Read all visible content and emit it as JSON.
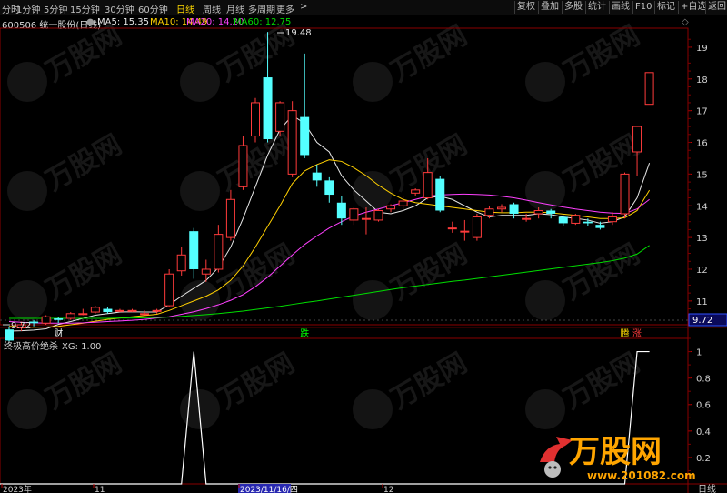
{
  "toolbar": {
    "tabs": [
      {
        "label": "分时",
        "active": false
      },
      {
        "label": "1分钟",
        "active": false
      },
      {
        "label": "5分钟",
        "active": false
      },
      {
        "label": "15分钟",
        "active": false
      },
      {
        "label": "30分钟",
        "active": false
      },
      {
        "label": "60分钟",
        "active": false
      },
      {
        "label": "日线",
        "active": true
      },
      {
        "label": "周线",
        "active": false
      },
      {
        "label": "月线",
        "active": false
      },
      {
        "label": "多周期",
        "active": false
      },
      {
        "label": "更多",
        "active": false
      }
    ],
    "more_arrow": ">",
    "right_buttons": [
      "复权",
      "叠加",
      "多股",
      "统计",
      "画线",
      "F10",
      "标记",
      "+自选",
      "返回"
    ]
  },
  "info": {
    "stock": "600506 统一股份(日线)",
    "ma5": "MA5: 15.35",
    "ma10": "MA10: 14.49",
    "ma20": "MA20: 14.20",
    "ma60": "MA60: 12.75",
    "diamond": "◇"
  },
  "indicator": {
    "title": "终极高价绝杀",
    "value": "XG: 1.00",
    "period_label": "日线"
  },
  "colors": {
    "up": "#ff3b3b",
    "down": "#54ffff",
    "ma5": "#e8e8e8",
    "ma10": "#ffd000",
    "ma20": "#ff40ff",
    "ma60": "#00dd00",
    "signal": "#ffffff",
    "axis": "#c00000"
  },
  "watermark": {
    "logo_text": "万股网",
    "logo_url": "www.201082.com"
  },
  "chart_data": [
    {
      "type": "candlestick",
      "title": "600506 统一股份(日线)",
      "y_ticks": [
        11.0,
        12.0,
        13.0,
        14.0,
        15.0,
        16.0,
        17.0,
        18.0,
        19.0
      ],
      "ylim": [
        10.25,
        19.6
      ],
      "current_price": "9.72",
      "high_label": "19.48",
      "low_label": "9.72",
      "x_ticks": [
        "2023年",
        "11",
        "2023/11/16/四",
        "12"
      ],
      "markers": [
        {
          "index": 4,
          "text": "财",
          "color": "#ffffff"
        },
        {
          "index": 24,
          "text": "跌",
          "color": "#00ff00"
        },
        {
          "index": 50,
          "text": "腾",
          "color": "#ffd800"
        },
        {
          "index": 51,
          "text": "涨",
          "color": "#ff3b3b"
        }
      ],
      "candles": [
        {
          "o": 10.1,
          "c": 9.75,
          "h": 10.2,
          "l": 9.72
        },
        {
          "o": 10.15,
          "c": 10.25,
          "h": 10.35,
          "l": 10.05
        },
        {
          "o": 10.35,
          "c": 10.3,
          "h": 10.4,
          "l": 10.2
        },
        {
          "o": 10.3,
          "c": 10.5,
          "h": 10.55,
          "l": 10.25
        },
        {
          "o": 10.45,
          "c": 10.4,
          "h": 10.5,
          "l": 10.3
        },
        {
          "o": 10.45,
          "c": 10.6,
          "h": 10.65,
          "l": 10.4
        },
        {
          "o": 10.6,
          "c": 10.6,
          "h": 10.75,
          "l": 10.55
        },
        {
          "o": 10.65,
          "c": 10.8,
          "h": 10.85,
          "l": 10.6
        },
        {
          "o": 10.75,
          "c": 10.65,
          "h": 10.8,
          "l": 10.6
        },
        {
          "o": 10.7,
          "c": 10.7,
          "h": 10.75,
          "l": 10.65
        },
        {
          "o": 10.7,
          "c": 10.7,
          "h": 10.75,
          "l": 10.65
        },
        {
          "o": 10.6,
          "c": 10.6,
          "h": 10.7,
          "l": 10.55
        },
        {
          "o": 10.7,
          "c": 10.7,
          "h": 10.75,
          "l": 10.6
        },
        {
          "o": 10.85,
          "c": 11.85,
          "h": 12.0,
          "l": 10.8
        },
        {
          "o": 11.95,
          "c": 12.45,
          "h": 12.7,
          "l": 11.8
        },
        {
          "o": 13.2,
          "c": 12.0,
          "h": 13.3,
          "l": 11.7
        },
        {
          "o": 11.85,
          "c": 12.0,
          "h": 12.3,
          "l": 11.6
        },
        {
          "o": 12.0,
          "c": 13.1,
          "h": 13.4,
          "l": 11.9
        },
        {
          "o": 13.0,
          "c": 14.2,
          "h": 14.5,
          "l": 12.9
        },
        {
          "o": 14.6,
          "c": 15.9,
          "h": 16.2,
          "l": 14.5
        },
        {
          "o": 16.2,
          "c": 17.25,
          "h": 17.4,
          "l": 16.0
        },
        {
          "o": 18.05,
          "c": 16.1,
          "h": 19.48,
          "l": 16.0
        },
        {
          "o": 16.35,
          "c": 17.25,
          "h": 17.3,
          "l": 16.2
        },
        {
          "o": 15.0,
          "c": 17.0,
          "h": 17.3,
          "l": 14.9
        },
        {
          "o": 16.8,
          "c": 15.6,
          "h": 18.8,
          "l": 15.5
        },
        {
          "o": 15.05,
          "c": 14.8,
          "h": 15.3,
          "l": 14.6
        },
        {
          "o": 14.8,
          "c": 14.35,
          "h": 14.9,
          "l": 14.1
        },
        {
          "o": 14.1,
          "c": 13.6,
          "h": 14.3,
          "l": 13.4
        },
        {
          "o": 13.55,
          "c": 13.9,
          "h": 13.95,
          "l": 13.4
        },
        {
          "o": 13.6,
          "c": 13.6,
          "h": 13.95,
          "l": 13.1
        },
        {
          "o": 13.55,
          "c": 13.85,
          "h": 13.9,
          "l": 13.5
        },
        {
          "o": 13.9,
          "c": 14.0,
          "h": 14.05,
          "l": 13.8
        },
        {
          "o": 14.0,
          "c": 14.15,
          "h": 14.3,
          "l": 13.9
        },
        {
          "o": 14.4,
          "c": 14.5,
          "h": 14.55,
          "l": 14.3
        },
        {
          "o": 14.25,
          "c": 15.05,
          "h": 15.5,
          "l": 14.2
        },
        {
          "o": 14.85,
          "c": 13.85,
          "h": 14.95,
          "l": 13.8
        },
        {
          "o": 13.3,
          "c": 13.3,
          "h": 13.5,
          "l": 13.15
        },
        {
          "o": 13.2,
          "c": 13.2,
          "h": 13.55,
          "l": 12.9
        },
        {
          "o": 13.0,
          "c": 13.65,
          "h": 13.75,
          "l": 12.9
        },
        {
          "o": 13.7,
          "c": 13.9,
          "h": 14.0,
          "l": 13.6
        },
        {
          "o": 13.9,
          "c": 13.95,
          "h": 14.05,
          "l": 13.8
        },
        {
          "o": 14.05,
          "c": 13.75,
          "h": 14.1,
          "l": 13.6
        },
        {
          "o": 13.6,
          "c": 13.6,
          "h": 13.75,
          "l": 13.5
        },
        {
          "o": 13.75,
          "c": 13.85,
          "h": 13.95,
          "l": 13.6
        },
        {
          "o": 13.85,
          "c": 13.75,
          "h": 13.9,
          "l": 13.6
        },
        {
          "o": 13.65,
          "c": 13.45,
          "h": 13.7,
          "l": 13.35
        },
        {
          "o": 13.45,
          "c": 13.7,
          "h": 13.75,
          "l": 13.4
        },
        {
          "o": 13.5,
          "c": 13.45,
          "h": 13.6,
          "l": 13.35
        },
        {
          "o": 13.4,
          "c": 13.3,
          "h": 13.5,
          "l": 13.25
        },
        {
          "o": 13.5,
          "c": 13.65,
          "h": 13.8,
          "l": 13.4
        },
        {
          "o": 13.75,
          "c": 15.0,
          "h": 15.05,
          "l": 13.6
        },
        {
          "o": 15.7,
          "c": 16.5,
          "h": 16.5,
          "l": 14.95
        },
        {
          "o": 17.2,
          "c": 18.2,
          "h": 18.2,
          "l": 17.2
        }
      ],
      "series": [
        {
          "name": "MA5",
          "values": [
            10.05,
            10.06,
            10.08,
            10.12,
            10.26,
            10.35,
            10.45,
            10.55,
            10.6,
            10.65,
            10.66,
            10.65,
            10.65,
            10.88,
            11.15,
            11.4,
            11.65,
            12.05,
            12.7,
            13.6,
            14.6,
            15.6,
            16.4,
            16.85,
            16.6,
            16.0,
            15.7,
            14.95,
            14.5,
            14.15,
            13.8,
            13.75,
            13.85,
            14.0,
            14.25,
            14.3,
            14.2,
            14.0,
            13.8,
            13.65,
            13.7,
            13.7,
            13.7,
            13.75,
            13.72,
            13.65,
            13.6,
            13.55,
            13.45,
            13.5,
            13.65,
            14.25,
            15.35
          ]
        },
        {
          "name": "MA10",
          "values": [
            10.2,
            10.18,
            10.17,
            10.18,
            10.2,
            10.25,
            10.3,
            10.36,
            10.42,
            10.46,
            10.5,
            10.54,
            10.58,
            10.7,
            10.85,
            11.0,
            11.15,
            11.35,
            11.65,
            12.1,
            12.7,
            13.35,
            14.0,
            14.7,
            15.1,
            15.3,
            15.45,
            15.4,
            15.2,
            14.95,
            14.65,
            14.4,
            14.2,
            14.1,
            14.05,
            14.0,
            13.95,
            13.9,
            13.85,
            13.8,
            13.78,
            13.78,
            13.8,
            13.8,
            13.78,
            13.74,
            13.7,
            13.65,
            13.6,
            13.6,
            13.62,
            13.85,
            14.49
          ]
        },
        {
          "name": "MA20",
          "values": [
            10.35,
            10.33,
            10.31,
            10.3,
            10.3,
            10.3,
            10.31,
            10.33,
            10.35,
            10.37,
            10.39,
            10.42,
            10.46,
            10.5,
            10.58,
            10.66,
            10.76,
            10.88,
            11.02,
            11.2,
            11.45,
            11.75,
            12.1,
            12.45,
            12.78,
            13.05,
            13.3,
            13.5,
            13.68,
            13.8,
            13.9,
            14.0,
            14.1,
            14.2,
            14.3,
            14.34,
            14.36,
            14.37,
            14.36,
            14.34,
            14.3,
            14.25,
            14.18,
            14.1,
            14.03,
            13.96,
            13.9,
            13.85,
            13.8,
            13.77,
            13.76,
            13.9,
            14.2
          ]
        },
        {
          "name": "MA60",
          "values": [
            10.45,
            10.45,
            10.45,
            10.45,
            10.45,
            10.45,
            10.45,
            10.45,
            10.45,
            10.46,
            10.46,
            10.47,
            10.48,
            10.49,
            10.51,
            10.54,
            10.57,
            10.6,
            10.64,
            10.68,
            10.73,
            10.78,
            10.83,
            10.89,
            10.95,
            11.0,
            11.06,
            11.12,
            11.18,
            11.24,
            11.3,
            11.36,
            11.42,
            11.47,
            11.52,
            11.57,
            11.62,
            11.66,
            11.71,
            11.76,
            11.81,
            11.86,
            11.91,
            11.96,
            12.01,
            12.06,
            12.11,
            12.16,
            12.21,
            12.27,
            12.35,
            12.48,
            12.75
          ]
        }
      ]
    },
    {
      "type": "line",
      "title": "终极高价绝杀",
      "series": [
        {
          "name": "XG",
          "values": [
            0,
            0,
            0,
            0,
            0,
            0,
            0,
            0,
            0,
            0,
            0,
            0,
            0,
            0,
            0,
            1,
            0,
            0,
            0,
            0,
            0,
            0,
            0,
            0,
            0,
            0,
            0,
            0,
            0,
            0,
            0,
            0,
            0,
            0,
            0,
            0,
            0,
            0,
            0,
            0,
            0,
            0,
            0,
            0,
            0,
            0,
            0,
            0,
            0,
            0,
            0,
            1,
            1
          ]
        }
      ],
      "y_ticks": [
        0.2,
        0.4,
        0.6,
        0.8,
        1.0
      ],
      "ylim": [
        0,
        1.1
      ]
    }
  ]
}
